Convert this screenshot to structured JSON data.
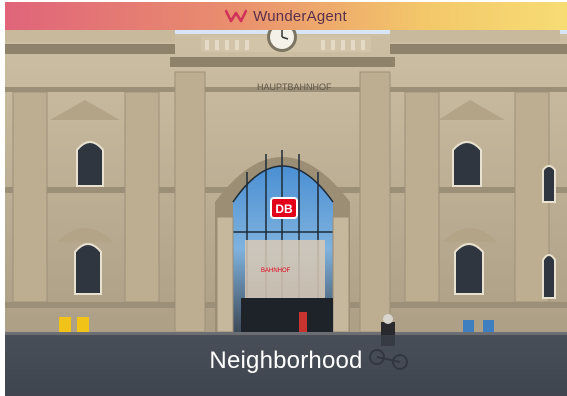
{
  "brand": {
    "name": "WunderAgent",
    "logo_icon": "w-chevron-logo-icon",
    "gradient_colors": [
      "#e0647a",
      "#e98e6e",
      "#f3c86a",
      "#f7dc74"
    ],
    "text_color": "#5a2f4a"
  },
  "photo": {
    "facade_sign": "HAUPTBAHNHOF",
    "station_logo": "DB",
    "inner_sign": "BAHNHOF",
    "accent_color": "#e3001b"
  },
  "caption": {
    "text": "Neighborhood"
  }
}
